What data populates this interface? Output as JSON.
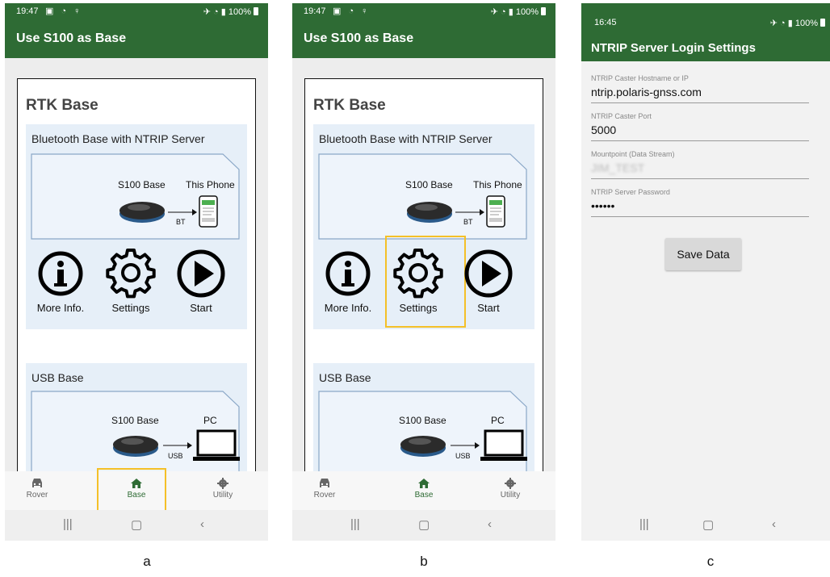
{
  "colors": {
    "app_green": "#2e6b34",
    "highlight": "#f4c028",
    "card_bg": "#e6eff8"
  },
  "panel_a": {
    "status_time": "19:47",
    "status_icons_left": "▣ ◔ ♀",
    "status_icons_right": "✈ ◔ ▮ 100%",
    "app_title": "Use S100 as Base",
    "rtk_title": "RTK Base",
    "card1": {
      "title": "Bluetooth Base with NTRIP Server",
      "device_label": "S100 Base",
      "target_label": "This Phone",
      "link_label": "BT",
      "actions": [
        "More Info.",
        "Settings",
        "Start"
      ]
    },
    "card2": {
      "title": "USB Base",
      "device_label": "S100 Base",
      "target_label": "PC",
      "link_label": "USB"
    },
    "nav": [
      {
        "label": "Rover",
        "icon": "car-icon"
      },
      {
        "label": "Base",
        "icon": "home-icon"
      },
      {
        "label": "Utility",
        "icon": "gear-icon"
      }
    ],
    "active_nav": "Base",
    "sysnav": {
      "recents": "|||",
      "home": "▢",
      "back": "‹"
    }
  },
  "panel_b": {
    "status_time": "19:47",
    "status_icons_left": "▣ ◔ ♀",
    "status_icons_right": "✈ ◔ ▮ 100%",
    "app_title": "Use S100 as Base",
    "rtk_title": "RTK Base",
    "card1": {
      "title": "Bluetooth Base with NTRIP Server",
      "device_label": "S100 Base",
      "target_label": "This Phone",
      "link_label": "BT",
      "actions": [
        "More Info.",
        "Settings",
        "Start"
      ]
    },
    "card2": {
      "title": "USB Base",
      "device_label": "S100 Base",
      "target_label": "PC",
      "link_label": "USB"
    },
    "nav": [
      {
        "label": "Rover",
        "icon": "car-icon"
      },
      {
        "label": "Base",
        "icon": "home-icon"
      },
      {
        "label": "Utility",
        "icon": "gear-icon"
      }
    ],
    "active_nav": "Base",
    "sysnav": {
      "recents": "|||",
      "home": "▢",
      "back": "‹"
    }
  },
  "panel_c": {
    "status_time": "16:45",
    "status_icons_right": "✈ ◔ ▮ 100%",
    "app_title": "NTRIP Server Login Settings",
    "fields": [
      {
        "label": "NTRIP Caster Hostname or IP",
        "value": "ntrip.polaris-gnss.com"
      },
      {
        "label": "NTRIP Caster Port",
        "value": "5000"
      },
      {
        "label": "Mountpoint (Data Stream)",
        "value": "JIM_TEST"
      },
      {
        "label": "NTRIP Server Password",
        "value": "••••••"
      }
    ],
    "save_label": "Save Data",
    "sysnav": {
      "recents": "|||",
      "home": "▢",
      "back": "‹"
    }
  },
  "captions": [
    "a",
    "b",
    "c"
  ]
}
